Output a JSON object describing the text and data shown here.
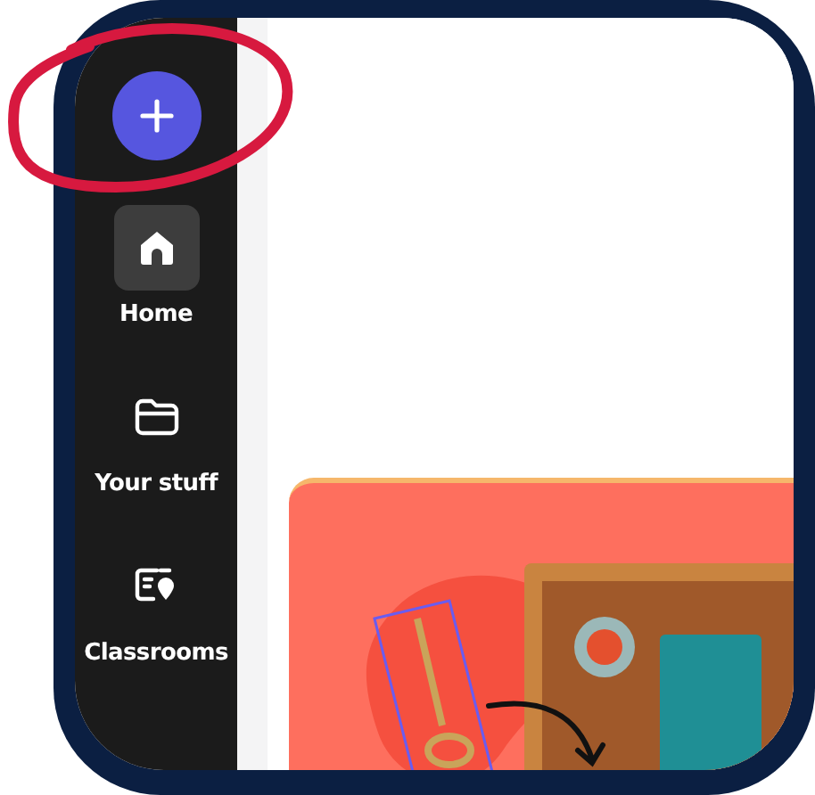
{
  "sidebar": {
    "create_button": {
      "selected": false
    },
    "items": [
      {
        "kind": "home",
        "label": "Home",
        "selected": true
      },
      {
        "kind": "folder",
        "label": "Your stuff",
        "selected": false
      },
      {
        "kind": "classroom",
        "label": "Classrooms",
        "selected": false
      }
    ]
  },
  "annotation": {
    "kind": "circle",
    "color": "#d7193f"
  }
}
